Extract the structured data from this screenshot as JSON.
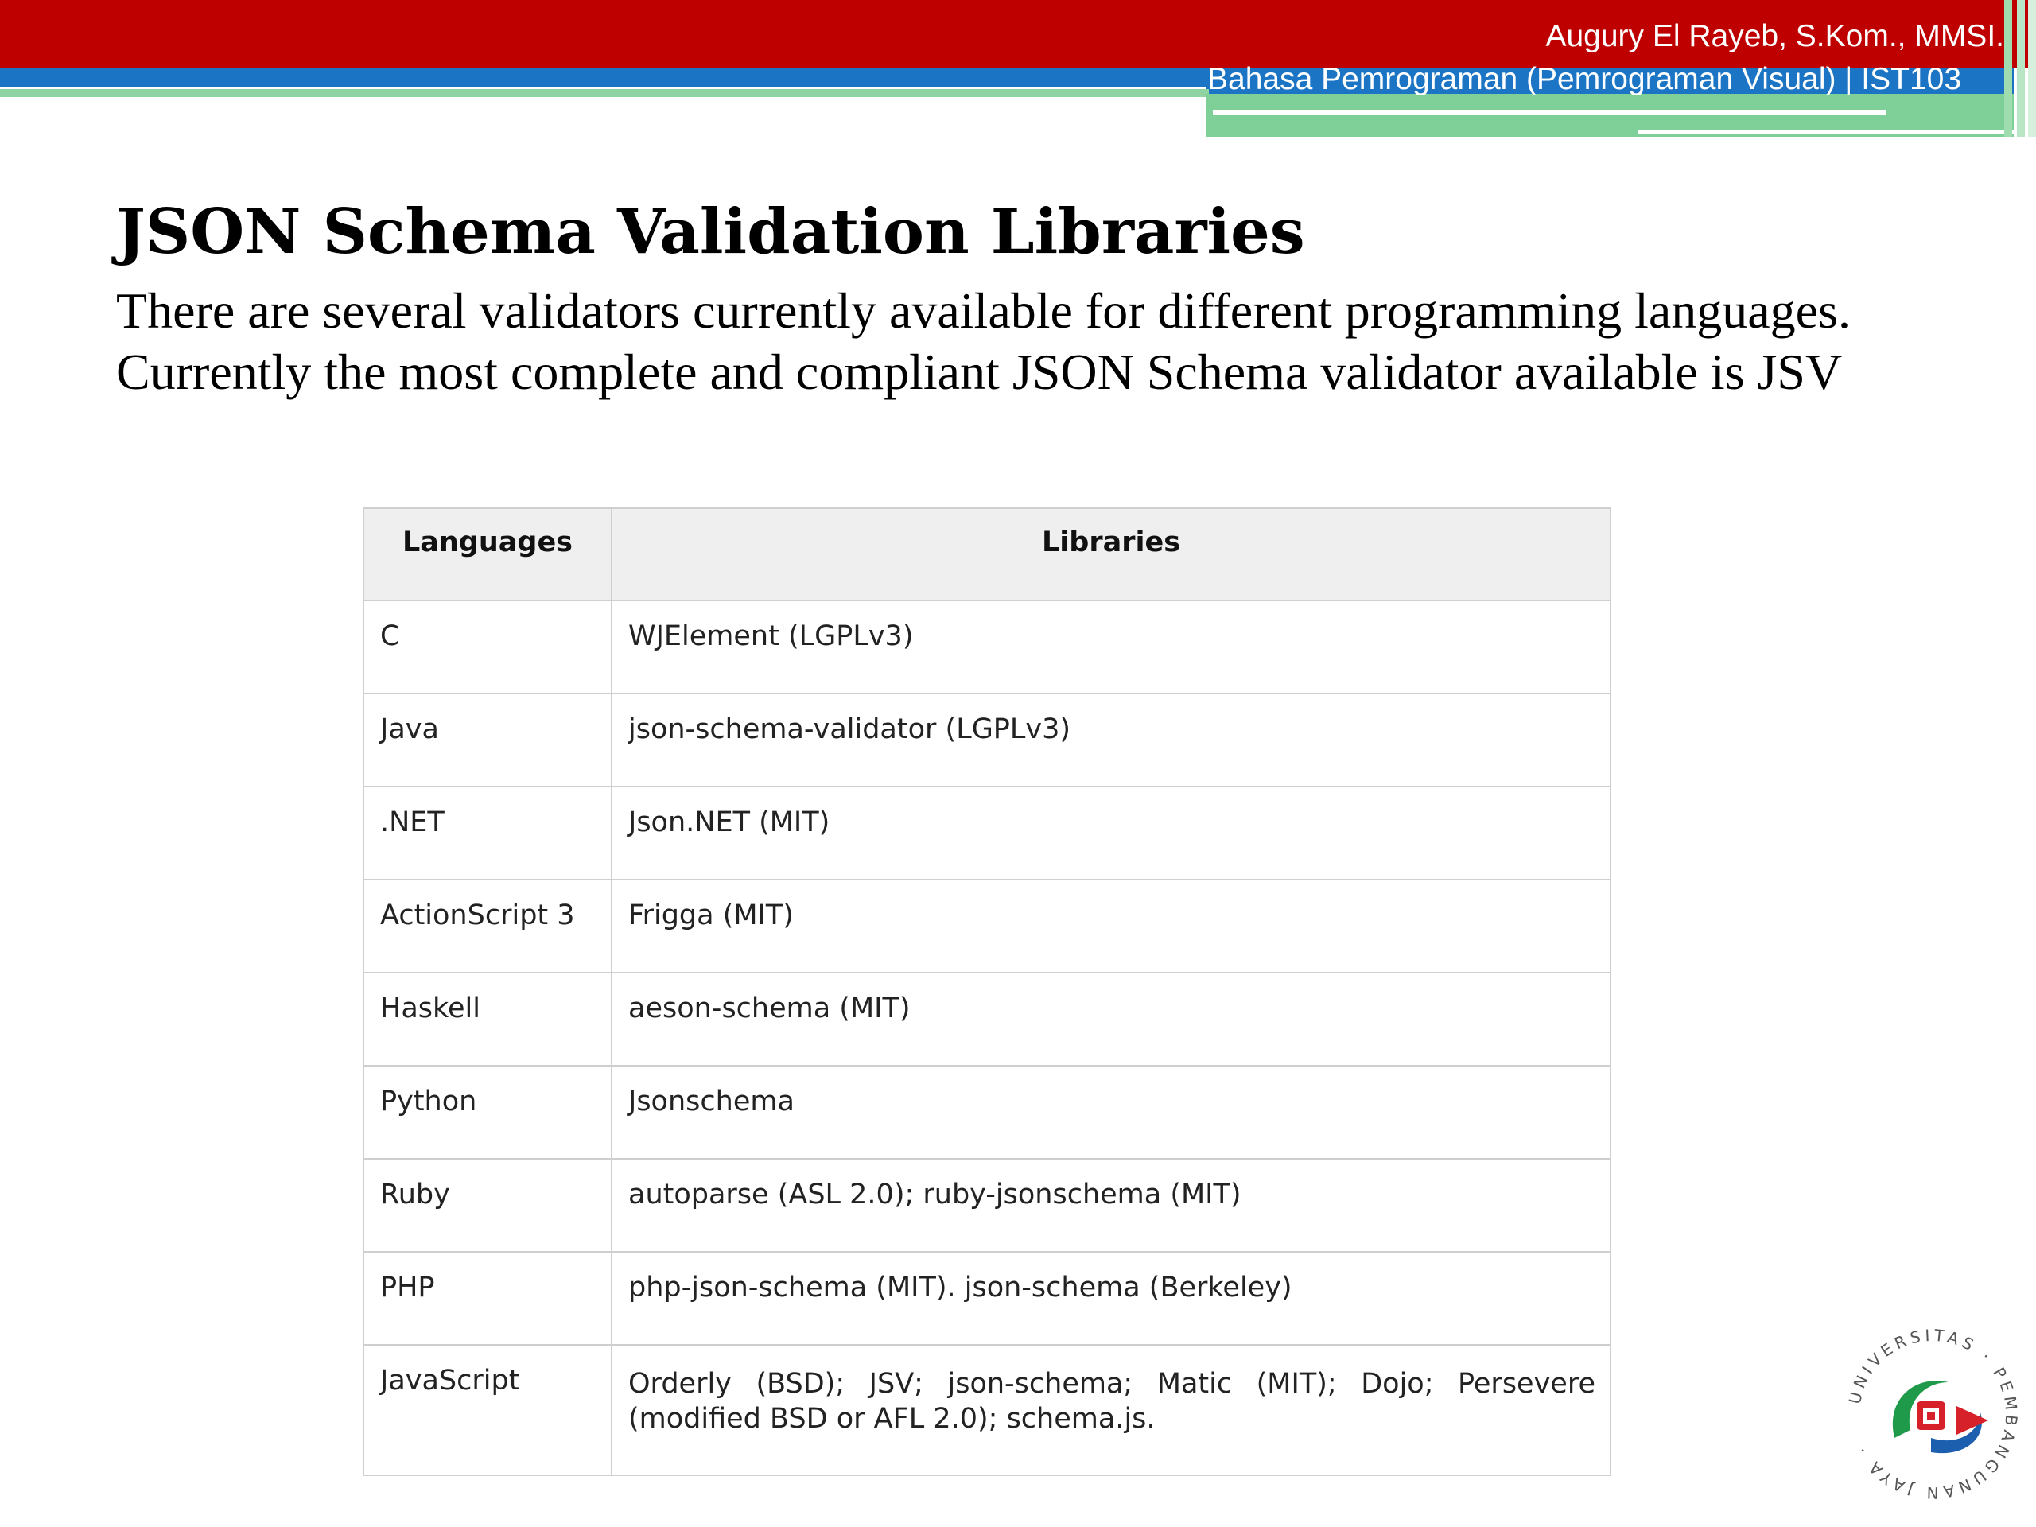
{
  "header": {
    "author": "Augury El Rayeb, S.Kom., MMSI.",
    "course": "Bahasa Pemrograman (Pemrograman Visual) | IST103"
  },
  "slide": {
    "title": "JSON Schema Validation Libraries",
    "intro": "There are several validators currently available for different programming languages. Currently the most complete and compliant JSON Schema validator available is JSV"
  },
  "table": {
    "columns": [
      "Languages",
      "Libraries"
    ],
    "rows": [
      {
        "language": "C",
        "libraries": "WJElement (LGPLv3)"
      },
      {
        "language": "Java",
        "libraries": "json-schema-validator (LGPLv3)"
      },
      {
        "language": ".NET",
        "libraries": "Json.NET (MIT)"
      },
      {
        "language": "ActionScript 3",
        "libraries": "Frigga (MIT)"
      },
      {
        "language": "Haskell",
        "libraries": "aeson-schema (MIT)"
      },
      {
        "language": "Python",
        "libraries": "Jsonschema"
      },
      {
        "language": "Ruby",
        "libraries": "autoparse (ASL 2.0); ruby-jsonschema (MIT)"
      },
      {
        "language": "PHP",
        "libraries": "php-json-schema (MIT). json-schema (Berkeley)"
      },
      {
        "language": "JavaScript",
        "libraries": "Orderly (BSD); JSV; json-schema; Matic (MIT); Dojo; Persevere (modified BSD or AFL 2.0); schema.js."
      }
    ]
  },
  "logo": {
    "text": "UNIVERSITAS · PEMBANGUNAN JAYA ·",
    "colors": {
      "red": "#d6202a",
      "blue": "#1c5fae",
      "green": "#1f9a4a"
    }
  },
  "theme": {
    "header_red": "#be0000",
    "header_blue": "#1c75c4",
    "header_green": "#7fcf98"
  }
}
